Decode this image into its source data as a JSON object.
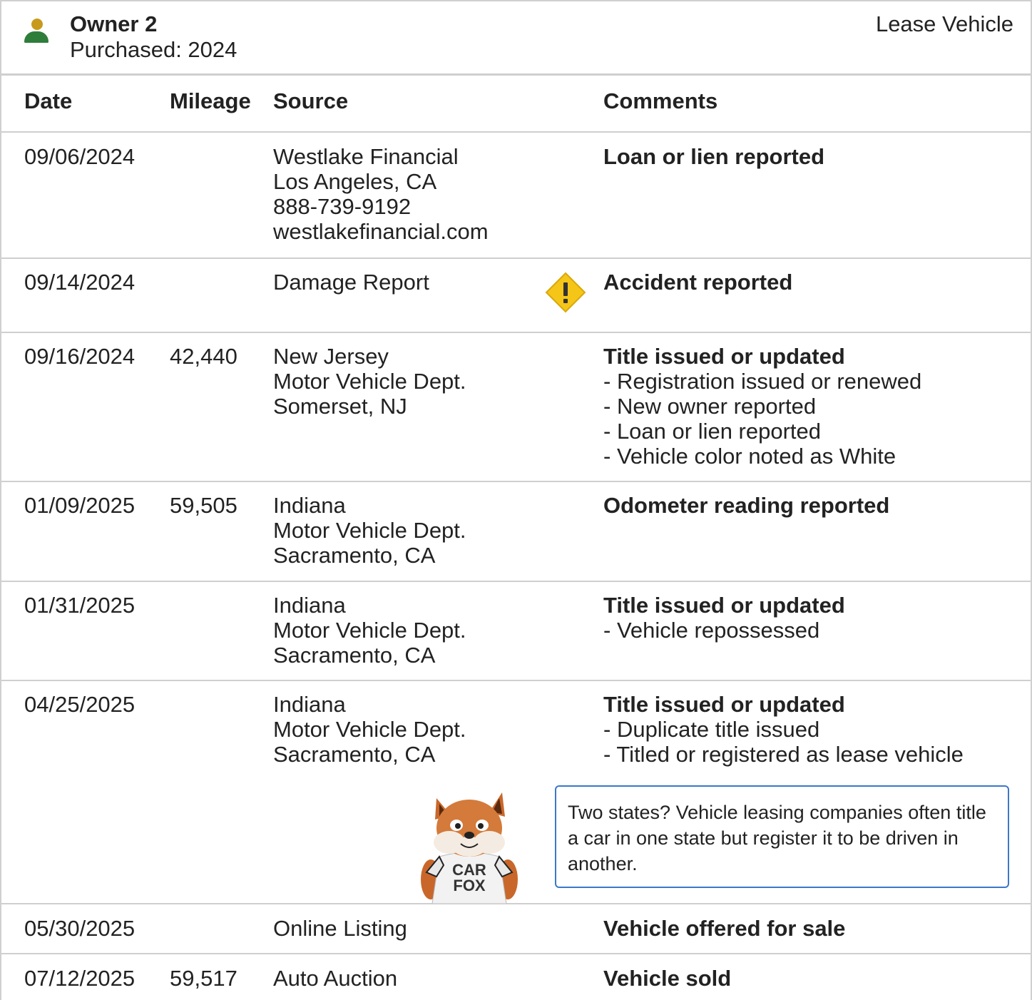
{
  "owner": {
    "title": "Owner 2",
    "purchased": "Purchased: 2024",
    "vehicle_type": "Lease Vehicle",
    "icon": "person-icon",
    "icon_colors": {
      "head": "#c89a1c",
      "body": "#2f7d3b"
    }
  },
  "columns": {
    "date": "Date",
    "mileage": "Mileage",
    "source": "Source",
    "comments": "Comments"
  },
  "records": [
    {
      "date": "09/06/2024",
      "mileage": "",
      "source": [
        "Westlake Financial",
        "Los Angeles, CA",
        "888-739-9192",
        "westlakefinancial.com"
      ],
      "title": "Loan or lien reported",
      "details": []
    },
    {
      "date": "09/14/2024",
      "mileage": "",
      "source": [
        "Damage Report"
      ],
      "title": "Accident reported",
      "details": [],
      "icon": "warning-icon"
    },
    {
      "date": "09/16/2024",
      "mileage": "42,440",
      "source": [
        "New Jersey",
        "Motor Vehicle Dept.",
        "Somerset, NJ"
      ],
      "title": "Title issued or updated",
      "details": [
        "Registration issued or renewed",
        "New owner reported",
        "Loan or lien reported",
        "Vehicle color noted as White"
      ]
    },
    {
      "date": "01/09/2025",
      "mileage": "59,505",
      "source": [
        "Indiana",
        "Motor Vehicle Dept.",
        "Sacramento, CA"
      ],
      "title": "Odometer reading reported",
      "details": []
    },
    {
      "date": "01/31/2025",
      "mileage": "",
      "source": [
        "Indiana",
        "Motor Vehicle Dept.",
        "Sacramento, CA"
      ],
      "title": "Title issued or updated",
      "details": [
        "Vehicle repossessed"
      ]
    },
    {
      "date": "04/25/2025",
      "mileage": "",
      "source": [
        "Indiana",
        "Motor Vehicle Dept.",
        "Sacramento, CA"
      ],
      "title": "Title issued or updated",
      "details": [
        "Duplicate title issued",
        "Titled or registered as lease vehicle"
      ]
    },
    {
      "date": "05/30/2025",
      "mileage": "",
      "source": [
        "Online Listing"
      ],
      "title": "Vehicle offered for sale",
      "details": []
    },
    {
      "date": "07/12/2025",
      "mileage": "59,517",
      "source": [
        "Auto Auction"
      ],
      "title": "Vehicle sold",
      "details": []
    }
  ],
  "tip": {
    "text": "Two states? Vehicle leasing companies often title a car in one state but register it to be driven in another.",
    "mascot_shirt": "CAR FOX",
    "border_color": "#3a78c9"
  },
  "colors": {
    "warning": "#f5c518",
    "rule": "#cfcfcf"
  }
}
